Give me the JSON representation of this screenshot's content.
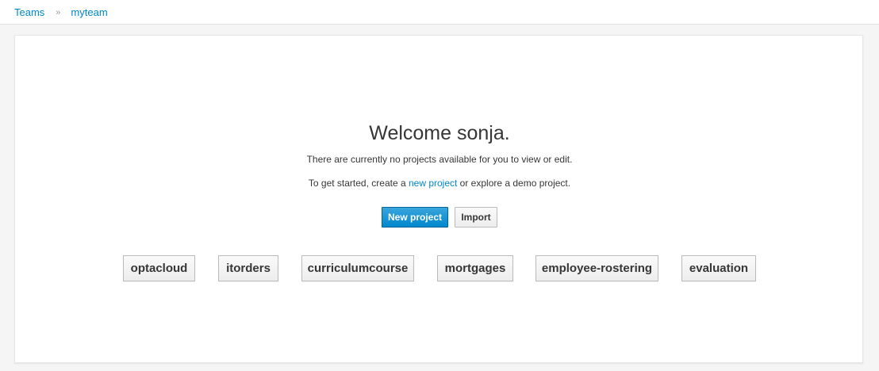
{
  "breadcrumb": {
    "items": [
      {
        "label": "Teams"
      },
      {
        "label": "myteam"
      }
    ],
    "separator": "»"
  },
  "welcome": {
    "title": "Welcome sonja.",
    "no_projects_text": "There are currently no projects available for you to view or edit.",
    "get_started_prefix": "To get started, create a ",
    "new_project_link": "new project",
    "get_started_suffix": " or explore a demo project."
  },
  "actions": {
    "new_project_label": "New project",
    "import_label": "Import"
  },
  "demo_projects": [
    {
      "label": "optacloud"
    },
    {
      "label": "itorders"
    },
    {
      "label": "curriculumcourse"
    },
    {
      "label": "mortgages"
    },
    {
      "label": "employee-rostering"
    },
    {
      "label": "evaluation"
    }
  ],
  "colors": {
    "link": "#0088ce",
    "primary": "#0088ce",
    "background": "#f5f5f5",
    "card": "#ffffff"
  }
}
